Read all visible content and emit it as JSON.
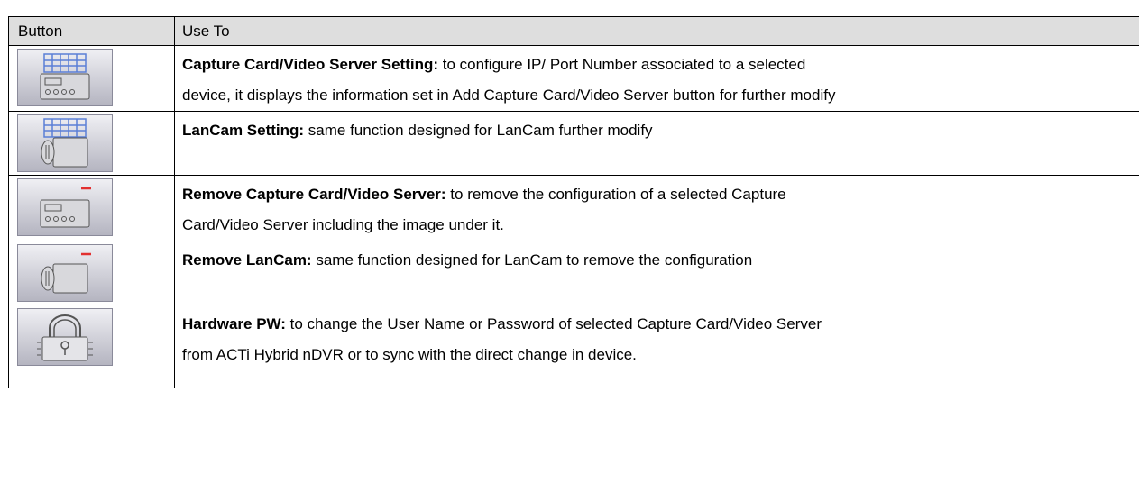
{
  "header": {
    "col_button": "Button",
    "col_use": "Use To"
  },
  "rows": [
    {
      "icon": "capture-card-setting-icon",
      "title": "Capture Card/Video Server Setting:",
      "text1": " to configure IP/ Port Number associated to a selected",
      "text2": "device, it displays the information set in Add Capture Card/Video Server button for further modify"
    },
    {
      "icon": "lancam-setting-icon",
      "title": "LanCam Setting:",
      "text1": " same function designed for LanCam further modify",
      "text2": ""
    },
    {
      "icon": "remove-capture-card-icon",
      "title": "Remove Capture Card/Video Server:",
      "text1": " to remove the configuration of a selected Capture",
      "text2": "Card/Video Server including the image under it."
    },
    {
      "icon": "remove-lancam-icon",
      "title": "Remove LanCam:",
      "text1": " same function designed for LanCam to remove the configuration",
      "text2": ""
    },
    {
      "icon": "hardware-password-icon",
      "title": "Hardware PW:",
      "text1": " to change the User Name or Password of selected Capture Card/Video Server",
      "text2": "from ACTi Hybrid nDVR or to sync with the direct change in device."
    }
  ],
  "colors": {
    "icon_bg_top": "#e8e8ee",
    "icon_bg_bottom": "#b9b9c4",
    "grid_blue": "#5b7fd6",
    "minus_red": "#e23030"
  }
}
